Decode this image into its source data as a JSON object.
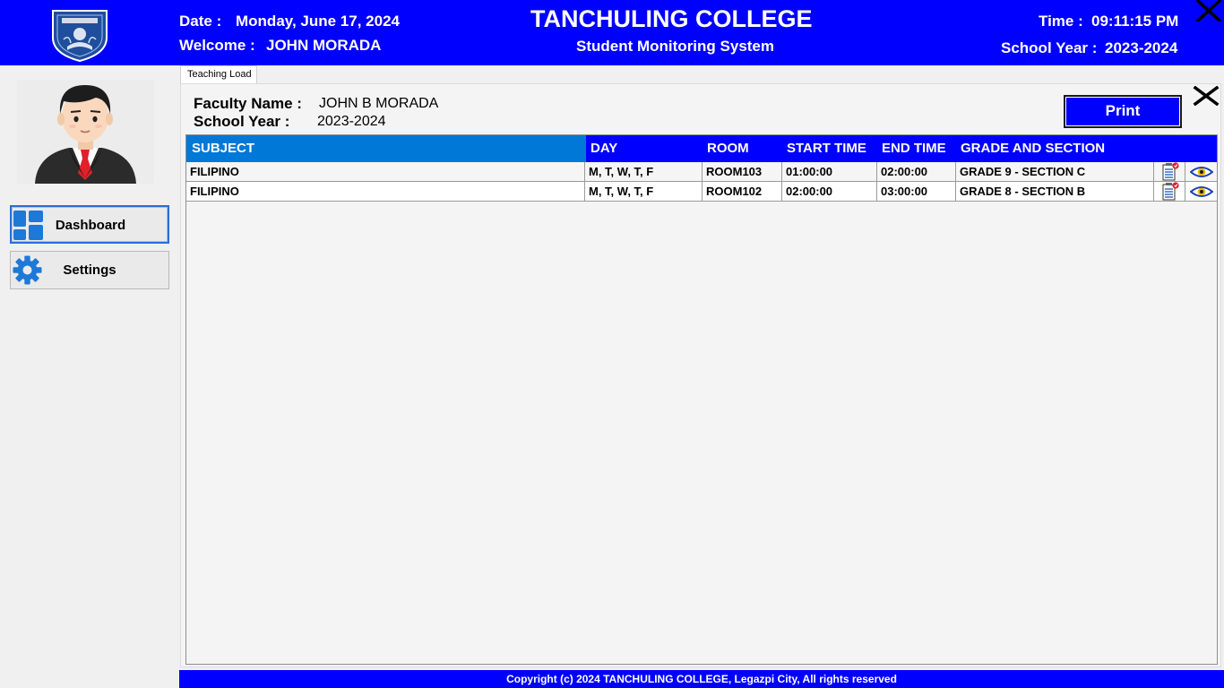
{
  "header": {
    "date_label": "Date :",
    "date_value": "Monday, June 17, 2024",
    "welcome_label": "Welcome :",
    "welcome_value": "JOHN MORADA",
    "college_name": "TANCHULING COLLEGE",
    "system_name": "Student Monitoring System",
    "time_label": "Time :",
    "time_value": "09:11:15 PM",
    "school_year_label": "School Year :",
    "school_year_value": "2023-2024",
    "logo_icon": "college-seal-icon",
    "close_icon": "close-icon"
  },
  "sidebar": {
    "avatar_icon": "user-avatar-icon",
    "items": [
      {
        "label": "Dashboard",
        "icon": "dashboard-icon",
        "active": true
      },
      {
        "label": "Settings",
        "icon": "gear-icon",
        "active": false
      }
    ]
  },
  "tab": {
    "label": "Teaching Load"
  },
  "info": {
    "faculty_label": "Faculty Name :",
    "faculty_value": "JOHN B MORADA",
    "school_year_label": "School Year :",
    "school_year_value": "2023-2024"
  },
  "actions": {
    "print_label": "Print"
  },
  "table": {
    "columns": [
      "SUBJECT",
      "DAY",
      "ROOM",
      "START TIME",
      "END TIME",
      "GRADE AND SECTION"
    ],
    "rows": [
      {
        "subject": "FILIPINO",
        "day": "M, T, W, T, F",
        "room": "ROOM103",
        "start": "01:00:00",
        "end": "02:00:00",
        "grade_section": "GRADE 9 - SECTION C"
      },
      {
        "subject": "FILIPINO",
        "day": "M, T, W, T, F",
        "room": "ROOM102",
        "start": "02:00:00",
        "end": "03:00:00",
        "grade_section": "GRADE 8 - SECTION B"
      }
    ],
    "row_action_icons": [
      "attendance-icon",
      "view-eye-icon"
    ]
  },
  "colors": {
    "header_blue": "#0000ff",
    "subject_header_blue": "#0078d7",
    "background": "#f0f0f0"
  },
  "footer": {
    "copyright": "Copyright (c) 2024 TANCHULING COLLEGE, Legazpi City, All rights reserved"
  }
}
